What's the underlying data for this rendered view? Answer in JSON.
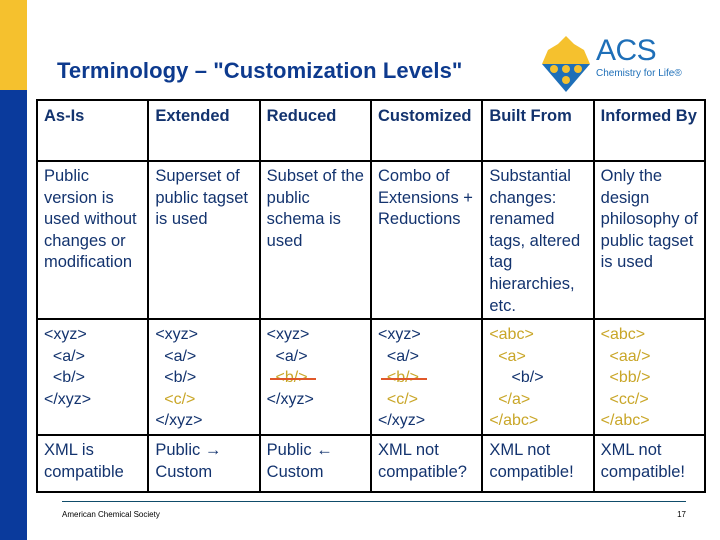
{
  "slide": {
    "title": "Terminology – \"Customization Levels\"",
    "logo": {
      "abbr": "ACS",
      "tagline": "Chemistry for Life®",
      "seal_letters": [
        "A",
        "C",
        "S"
      ]
    },
    "colors": {
      "navy": "#13336E",
      "title_blue": "#0D3A8E",
      "gold": "#C9A628",
      "strike_red": "#E0582A",
      "sidebar_yellow": "#F5C12E",
      "sidebar_blue": "#0A3A9C"
    }
  },
  "table": {
    "headers": [
      "As-Is",
      "Extended",
      "Reduced",
      "Customized",
      "Built From",
      "Informed By"
    ],
    "descriptions": [
      "Public version is used without changes or modification",
      "Superset of public tagset is used",
      "Subset of the public schema is used",
      "Combo of Extensions + Reductions",
      "Substantial changes: renamed tags, altered tag hierarchies, etc.",
      "Only the design philosophy of public tagset is used"
    ],
    "examples": [
      [
        {
          "text": "<xyz>",
          "style": "navy"
        },
        {
          "text": "  <a/>",
          "style": "navy"
        },
        {
          "text": "  <b/>",
          "style": "navy"
        },
        {
          "text": "</xyz>",
          "style": "navy"
        }
      ],
      [
        {
          "text": "<xyz>",
          "style": "navy"
        },
        {
          "text": "  <a/>",
          "style": "navy"
        },
        {
          "text": "  <b/>",
          "style": "navy"
        },
        {
          "text": "  <c/>",
          "style": "gold"
        },
        {
          "text": "</xyz>",
          "style": "navy"
        }
      ],
      [
        {
          "text": "<xyz>",
          "style": "navy"
        },
        {
          "text": "  <a/>",
          "style": "navy"
        },
        {
          "text": "  <b/>",
          "style": "strike"
        },
        {
          "text": "</xyz>",
          "style": "navy"
        }
      ],
      [
        {
          "text": "<xyz>",
          "style": "navy"
        },
        {
          "text": "  <a/>",
          "style": "navy"
        },
        {
          "text": "  <b/>",
          "style": "strike"
        },
        {
          "text": "  <c/>",
          "style": "gold"
        },
        {
          "text": "</xyz>",
          "style": "navy"
        }
      ],
      [
        {
          "text": "<abc>",
          "style": "gold"
        },
        {
          "text": "  <a>",
          "style": "gold"
        },
        {
          "text": "     <b/>",
          "style": "navy"
        },
        {
          "text": "  </a>",
          "style": "gold"
        },
        {
          "text": "</abc>",
          "style": "gold"
        }
      ],
      [
        {
          "text": "<abc>",
          "style": "gold"
        },
        {
          "text": "  <aa/>",
          "style": "gold"
        },
        {
          "text": "  <bb/>",
          "style": "gold"
        },
        {
          "text": "  <cc/>",
          "style": "gold"
        },
        {
          "text": "</abc>",
          "style": "gold"
        }
      ]
    ],
    "compatibility": [
      "XML is compatible",
      "Public → Custom",
      "Public ← Custom",
      "XML not compatible?",
      "XML not compatible!",
      "XML not compatible!"
    ]
  },
  "footer": {
    "organization": "American Chemical Society",
    "page_number": "17"
  }
}
